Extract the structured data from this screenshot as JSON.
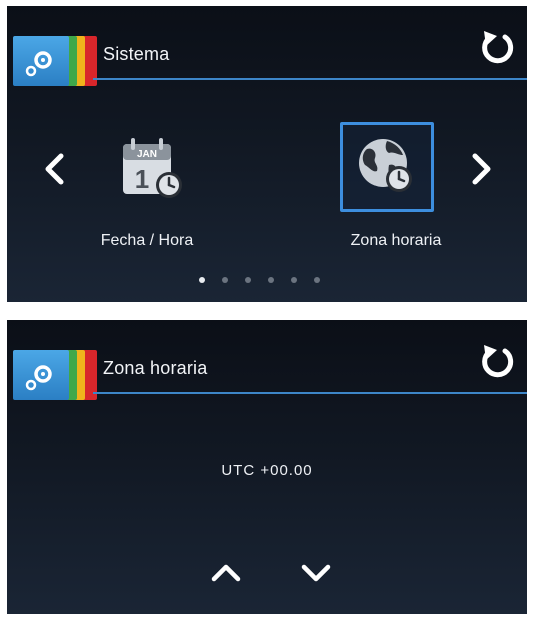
{
  "screen_top": {
    "title": "Sistema",
    "tiles": [
      {
        "label": "Fecha / Hora",
        "icon": "calendar-clock-icon",
        "calendar_month": "JAN",
        "calendar_day": "1"
      },
      {
        "label": "Zona horaria",
        "icon": "globe-clock-icon",
        "selected": true
      }
    ],
    "page_dots": {
      "count": 6,
      "active": 1
    }
  },
  "screen_bottom": {
    "title": "Zona horaria",
    "utc_value": "UTC +00.00"
  },
  "colors": {
    "accent_blue": "#3d86c8",
    "badge_blue": "#2b7fc4",
    "badge_red": "#d8262b",
    "badge_yellow": "#f0b31c",
    "badge_green": "#3fa84a",
    "text": "#eef1f5"
  },
  "icons": {
    "badge": "gears-icon",
    "refresh": "refresh-icon",
    "left": "chevron-left-icon",
    "right": "chevron-right-icon",
    "up": "chevron-up-icon",
    "down": "chevron-down-icon"
  }
}
